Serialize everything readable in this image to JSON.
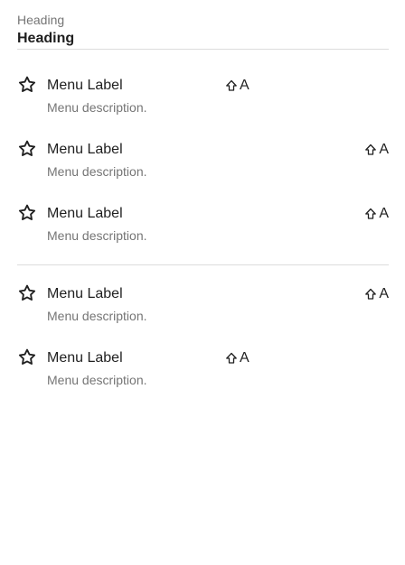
{
  "header": {
    "overline": "Heading",
    "title": "Heading"
  },
  "groups": [
    {
      "items": [
        {
          "icon": "star-outline-icon",
          "label": "Menu Label",
          "description": "Menu description.",
          "shortcut_key": "A",
          "shortcut_modifier_icon": "shift-icon"
        },
        {
          "icon": "star-outline-icon",
          "label": "Menu Label",
          "description": "Menu description.",
          "shortcut_key": "A",
          "shortcut_modifier_icon": "shift-icon"
        },
        {
          "icon": "star-outline-icon",
          "label": "Menu Label",
          "description": "Menu description.",
          "shortcut_key": "A",
          "shortcut_modifier_icon": "shift-icon"
        }
      ]
    },
    {
      "items": [
        {
          "icon": "star-outline-icon",
          "label": "Menu Label",
          "description": "Menu description.",
          "shortcut_key": "A",
          "shortcut_modifier_icon": "shift-icon"
        },
        {
          "icon": "star-outline-icon",
          "label": "Menu Label",
          "description": "Menu description.",
          "shortcut_key": "A",
          "shortcut_modifier_icon": "shift-icon"
        }
      ]
    }
  ],
  "colors": {
    "text_primary": "#1f1f1f",
    "text_secondary": "#757575",
    "divider": "#dcdcdc",
    "background": "#ffffff"
  }
}
